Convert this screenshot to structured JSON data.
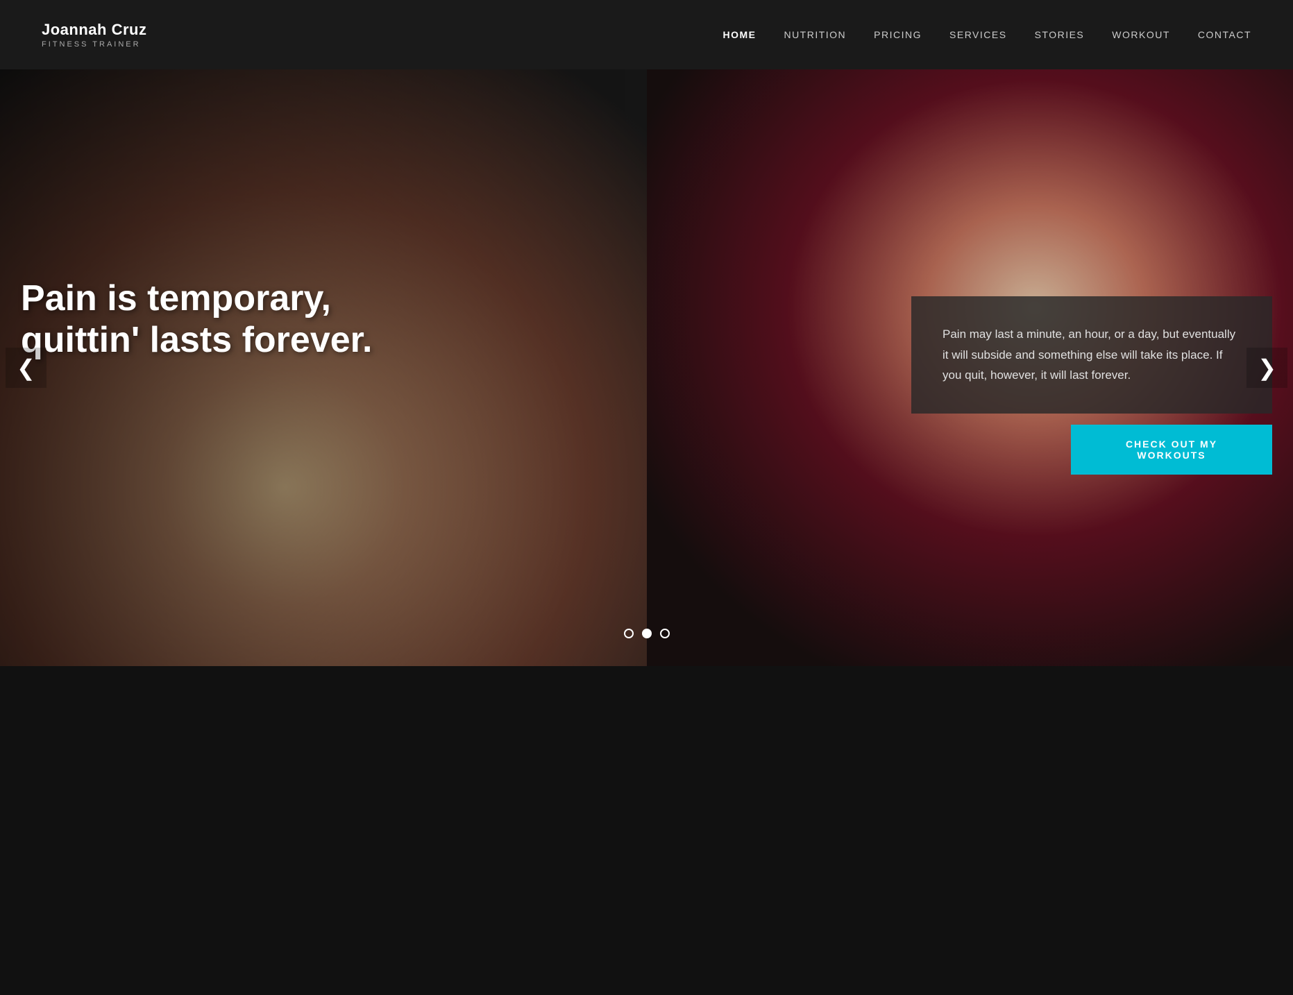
{
  "header": {
    "logo_name": "Joannah Cruz",
    "logo_subtitle": "FITNESS TRAINER",
    "nav_items": [
      {
        "label": "HOME",
        "active": true
      },
      {
        "label": "NUTRITION",
        "active": false
      },
      {
        "label": "PRICING",
        "active": false
      },
      {
        "label": "SERVICES",
        "active": false
      },
      {
        "label": "STORIES",
        "active": false
      },
      {
        "label": "WORKOUT",
        "active": false
      },
      {
        "label": "CONTACT",
        "active": false
      }
    ]
  },
  "hero": {
    "quote": "Pain is temporary, quittin' lasts forever.",
    "description": "Pain may last a minute, an hour, or a day, but eventually it will subside and something else will take its place. If you quit, however, it will last forever.",
    "cta_button": "CHECK OUT MY WORKOUTS",
    "arrow_left": "❮",
    "arrow_right": "❯",
    "dots": [
      {
        "index": 0,
        "active": false
      },
      {
        "index": 1,
        "active": true
      },
      {
        "index": 2,
        "active": false
      }
    ]
  }
}
